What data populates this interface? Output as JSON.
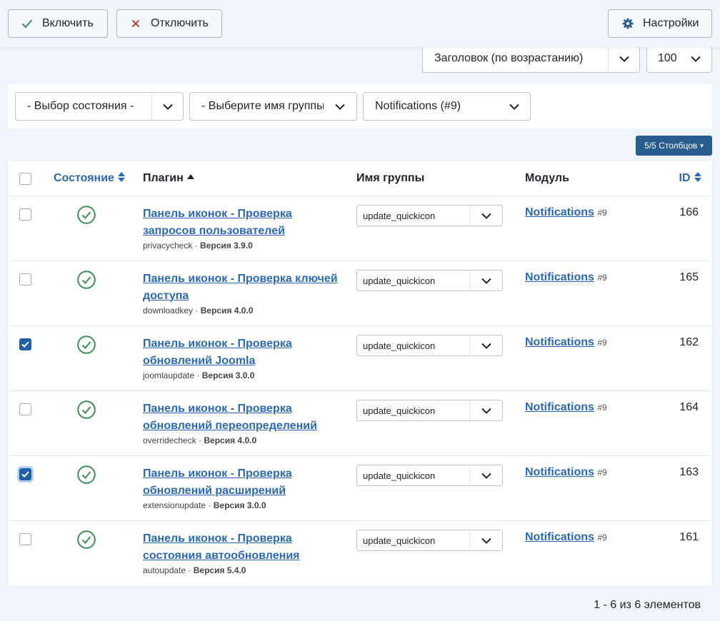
{
  "toolbar": {
    "enable_label": "Включить",
    "disable_label": "Отключить",
    "settings_label": "Настройки"
  },
  "list": {
    "ordering": "Заголовок (по возрастанию)",
    "limit": "100"
  },
  "filters": {
    "state": "- Выбор состояния -",
    "group": "- Выберите имя группы",
    "folder": "Notifications (#9)"
  },
  "columns_button": "5/5 Столбцов",
  "table": {
    "headers": {
      "state": "Состояние",
      "plugin": "Плагин",
      "group": "Имя группы",
      "module": "Модуль",
      "id": "ID"
    },
    "rows": [
      {
        "name": "Панель иконок - Проверка запросов пользователей",
        "element": "privacycheck",
        "version": "Версия 3.9.0",
        "group": "update_quickicon",
        "module": "Notifications",
        "module_tag": "#9",
        "id": "166",
        "checked": false
      },
      {
        "name": "Панель иконок - Проверка ключей доступа",
        "element": "downloadkey",
        "version": "Версия 4.0.0",
        "group": "update_quickicon",
        "module": "Notifications",
        "module_tag": "#9",
        "id": "165",
        "checked": false
      },
      {
        "name": "Панель иконок - Проверка обновлений Joomla",
        "element": "joomlaupdate",
        "version": "Версия 3.0.0",
        "group": "update_quickicon",
        "module": "Notifications",
        "module_tag": "#9",
        "id": "162",
        "checked": true
      },
      {
        "name": "Панель иконок - Проверка обновлений переопределений",
        "element": "overridecheck",
        "version": "Версия 4.0.0",
        "group": "update_quickicon",
        "module": "Notifications",
        "module_tag": "#9",
        "id": "164",
        "checked": false
      },
      {
        "name": "Панель иконок - Проверка обновлений расширений",
        "element": "extensionupdate",
        "version": "Версия 3.0.0",
        "group": "update_quickicon",
        "module": "Notifications",
        "module_tag": "#9",
        "id": "163",
        "checked": true
      },
      {
        "name": "Панель иконок - Проверка состояния автообновления",
        "element": "autoupdate",
        "version": "Версия 5.4.0",
        "group": "update_quickicon",
        "module": "Notifications",
        "module_tag": "#9",
        "id": "161",
        "checked": false
      }
    ]
  },
  "pagination_info": "1 - 6 из 6 элементов",
  "colors": {
    "accent": "#2a69b8",
    "success": "#3d8f5a",
    "primary_button": "#2a5d8f",
    "checked": "#1e5fa8"
  }
}
